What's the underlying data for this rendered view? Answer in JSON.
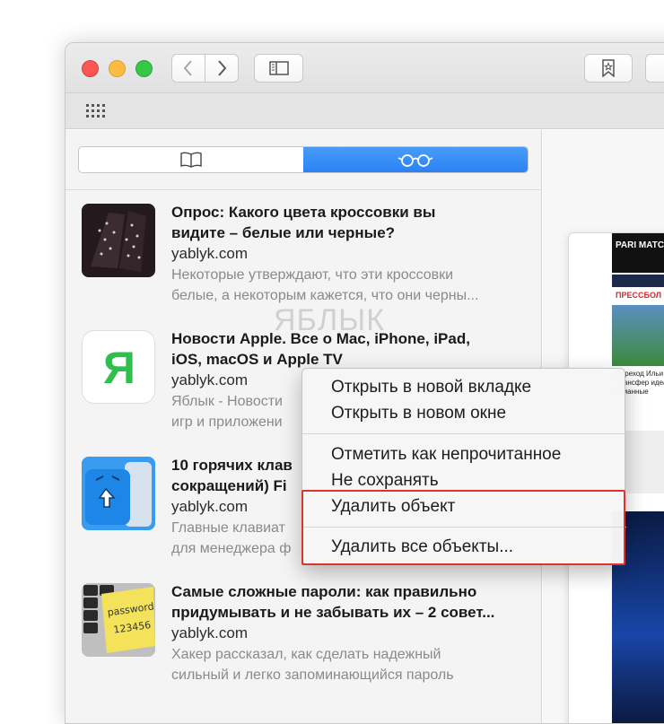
{
  "toolbar": {
    "back_icon": "chevron-left-icon",
    "forward_icon": "chevron-right-icon",
    "sidebar_icon": "sidebar-icon",
    "bookmark_icon": "star-bookmark-icon",
    "favorites_icon": "grid-icon"
  },
  "sidebar": {
    "tabs": [
      {
        "icon": "book-icon",
        "active": false
      },
      {
        "icon": "glasses-icon",
        "active": true
      }
    ],
    "items": [
      {
        "title": "Опрос: Какого цвета кроссовки вы\nвидите – белые или черные?",
        "domain": "yablyk.com",
        "description": "Некоторые утверждают, что эти кроссовки\nбелые, а некоторым кажется, что они черны..."
      },
      {
        "title": "Новости Apple. Все о Mac, iPhone, iPad,\niOS, macOS и Apple TV",
        "domain": "yablyk.com",
        "description": "Яблык - Новости\nигр и приложени"
      },
      {
        "title": "10 горячих клав\nсокращений) Fi",
        "domain": "yablyk.com",
        "description": "Главные клавиат\nдля менеджера ф"
      },
      {
        "title": "Самые сложные пароли: как правильно\nпридумывать и не забывать их – 2 совет...",
        "domain": "yablyk.com",
        "description": "Хакер рассказал, как сделать надежный\nсильный и легко запоминающийся пароль"
      }
    ]
  },
  "thumbnails": {
    "app_icon_letter": "Я",
    "password_note": "password\n123456"
  },
  "watermark": "ЯБЛЫК",
  "context_menu": {
    "groups": [
      [
        "Открыть в новой вкладке",
        "Открыть в новом окне"
      ],
      [
        "Отметить как непрочитанное",
        "Не сохранять",
        "Удалить объект"
      ],
      [
        "Удалить все объекты..."
      ]
    ]
  },
  "preview": {
    "brand": "PARI MATCH",
    "heading": "ПРЕССБОЛ",
    "headline": "Переход Ильи Ши Трансфер идеальн туманные"
  },
  "colors": {
    "accent": "#2c82f4",
    "highlight_border": "#e1322b",
    "traffic_close": "#fc5753",
    "traffic_min": "#fdbc40",
    "traffic_max": "#34c748"
  }
}
